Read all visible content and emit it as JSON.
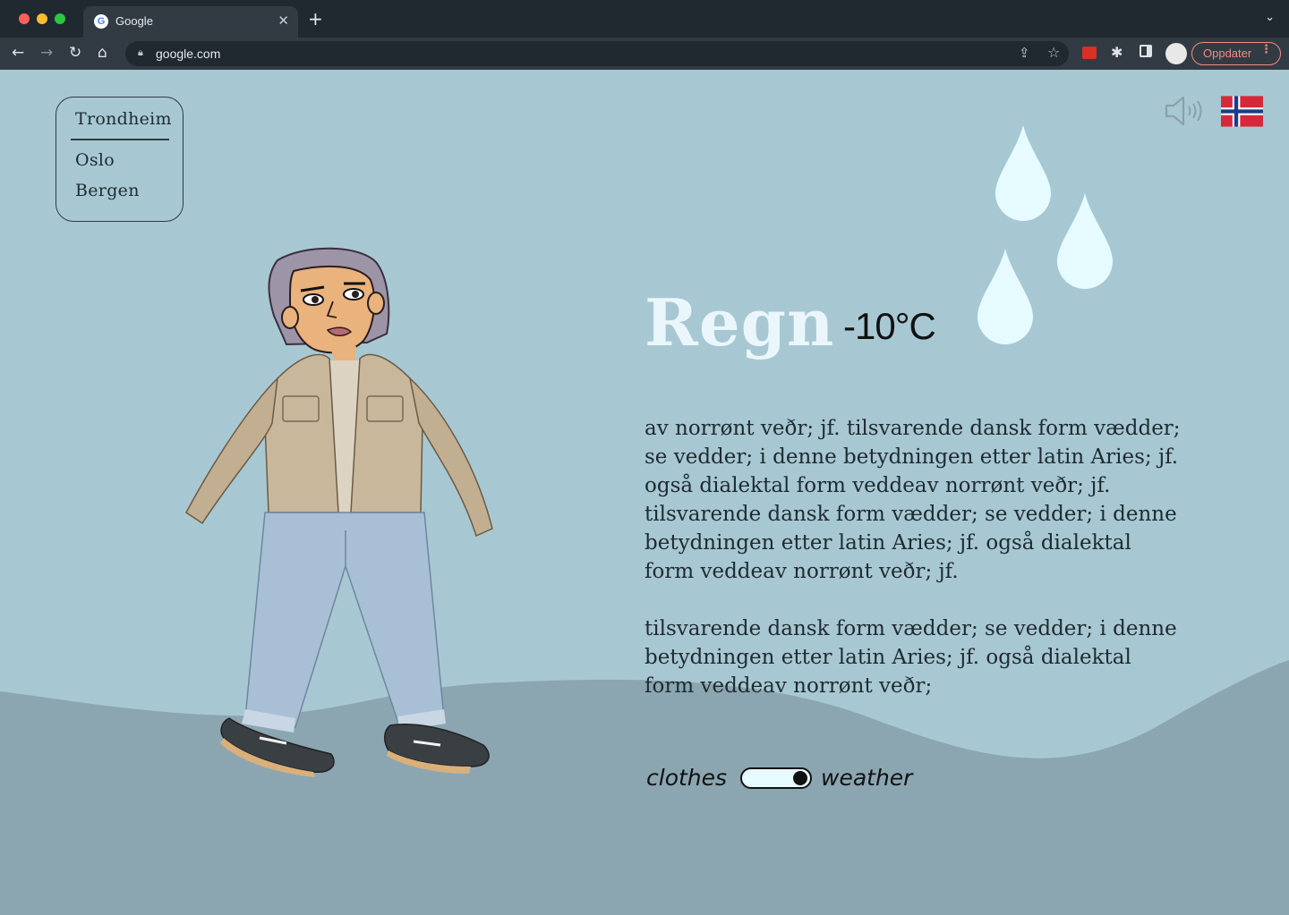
{
  "browser": {
    "tab_title": "Google",
    "tab_favicon": "G",
    "close_glyph": "✕",
    "newtab_glyph": "+",
    "tablist_glyph": "⌄",
    "url": "google.com",
    "update_label": "Oppdater",
    "nav": {
      "back": "←",
      "forward": "→",
      "reload": "↻",
      "home": "⌂"
    },
    "icons": [
      "share-icon",
      "star-icon",
      "extension-icon",
      "puzzle-icon",
      "sidepanel-icon",
      "profile-avatar"
    ]
  },
  "cities": {
    "selected": "Trondheim",
    "others": [
      "Oslo",
      "Bergen"
    ]
  },
  "weather": {
    "condition": "Regn",
    "temperature": "-10°C"
  },
  "description": {
    "paragraph1": "av norrønt veðr; jf. tilsvarende dansk form vædder; se vedder; i denne betydningen etter latin Aries; jf. også dialektal form veddeav norrønt veðr; jf. tilsvarende dansk form vædder; se vedder; i denne betydningen etter latin Aries; jf. også dialektal form veddeav norrønt veðr; jf.",
    "paragraph2": "tilsvarende dansk form vædder; se vedder; i denne betydningen etter latin Aries; jf. også dialektal form veddeav norrønt veðr;"
  },
  "toggle": {
    "left_label": "clothes",
    "right_label": "weather",
    "state": "weather"
  },
  "colors": {
    "background": "#a7c8d3",
    "hill": "#8ba6b1",
    "title": "#eaf6fb",
    "raindrop": "#e6fbff",
    "flag_red": "#d7283a",
    "flag_blue": "#1f3a8a"
  },
  "icons": {
    "sound": "speaker-icon",
    "language": "norway-flag-icon",
    "weather": "raindrops-icon"
  }
}
